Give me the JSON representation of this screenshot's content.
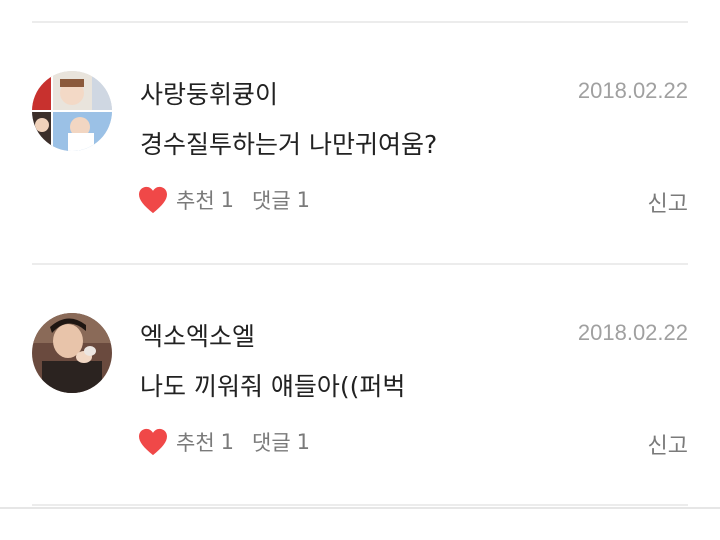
{
  "comments": [
    {
      "username": "사랑둥휘큥이",
      "date": "2018.02.22",
      "text": "경수질투하는거 나만귀여움?",
      "like_label": "추천",
      "like_count": "1",
      "reply_label": "댓글",
      "reply_count": "1",
      "report_label": "신고",
      "like_icon": "heart-icon",
      "like_color": "#f04848",
      "avatar": "collage-avatar"
    },
    {
      "username": "엑소엑소엘",
      "date": "2018.02.22",
      "text": "나도 끼워줘 얘들아((퍼벅",
      "like_label": "추천",
      "like_count": "1",
      "reply_label": "댓글",
      "reply_count": "1",
      "report_label": "신고",
      "like_icon": "heart-icon",
      "like_color": "#f04848",
      "avatar": "portrait-avatar"
    }
  ]
}
